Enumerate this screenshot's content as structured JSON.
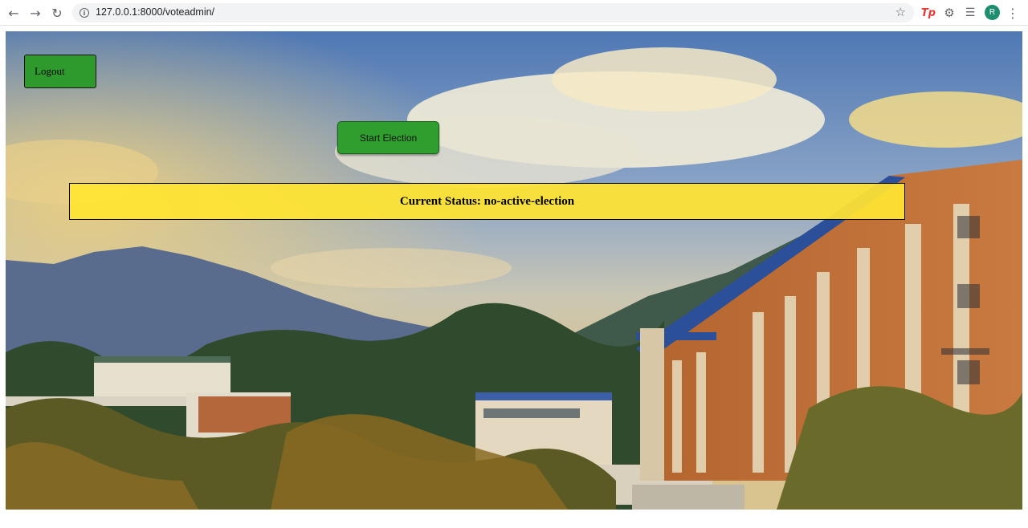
{
  "browser": {
    "url": "127.0.0.1:8000/voteadmin/",
    "icons": {
      "back": "arrow-left-icon",
      "forward": "arrow-right-icon",
      "reload": "reload-icon",
      "info": "info-icon",
      "bookmark": "star-icon",
      "extension_tp": "tp-extension-icon",
      "extensions": "puzzle-icon",
      "reading_list": "playlist-icon",
      "menu": "kebab-menu-icon"
    },
    "profile_initial": "R",
    "tp_label": "Tp"
  },
  "page": {
    "logout_label": "Logout",
    "start_election_label": "Start Election",
    "status_text": "Current Status: no-active-election",
    "background": "campus-landscape-image"
  },
  "colors": {
    "button_green": "#2e9a2e",
    "status_yellow": "#ffe432"
  }
}
